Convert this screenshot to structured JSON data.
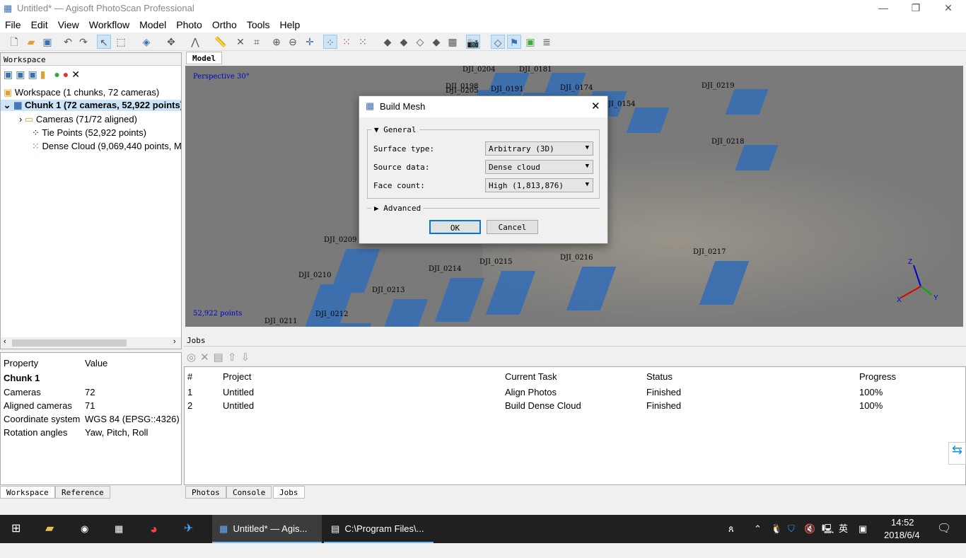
{
  "window": {
    "title": "Untitled* — Agisoft PhotoScan Professional"
  },
  "menu": [
    "File",
    "Edit",
    "View",
    "Workflow",
    "Model",
    "Photo",
    "Ortho",
    "Tools",
    "Help"
  ],
  "workspace": {
    "title": "Workspace",
    "root": "Workspace (1 chunks, 72 cameras)",
    "chunk": "Chunk 1 (72 cameras, 52,922 points)",
    "cameras": "Cameras (71/72 aligned)",
    "tie_points": "Tie Points (52,922 points)",
    "dense_cloud": "Dense Cloud (9,069,440 points, M"
  },
  "properties": {
    "header": [
      "Property",
      "Value"
    ],
    "group": "Chunk 1",
    "rows": [
      [
        "Cameras",
        "72"
      ],
      [
        "Aligned cameras",
        "71"
      ],
      [
        "Coordinate system",
        "WGS 84 (EPSG::4326)"
      ],
      [
        "Rotation angles",
        "Yaw, Pitch, Roll"
      ]
    ]
  },
  "left_tabs": [
    "Workspace",
    "Reference"
  ],
  "model": {
    "tab": "Model",
    "projection": "Perspective 30°",
    "points": "52,922 points",
    "cameras": [
      "DJI_0204",
      "DJI_0181",
      "DJI_0198",
      "DJI_0205",
      "DJI_0191",
      "DJI_0174",
      "DJI_0154",
      "DJI_0219",
      "DJI_0218",
      "DJI_0209",
      "DJI_0210",
      "DJI_0214",
      "DJI_0215",
      "DJI_0216",
      "DJI_0217",
      "DJI_0213",
      "DJI_0212",
      "DJI_0211"
    ],
    "axes": [
      "Z",
      "X",
      "Y"
    ]
  },
  "dialog": {
    "title": "Build Mesh",
    "general": "General",
    "advanced": "Advanced",
    "fields": [
      {
        "label": "Surface type:",
        "value": "Arbitrary (3D)"
      },
      {
        "label": "Source data:",
        "value": "Dense cloud"
      },
      {
        "label": "Face count:",
        "value": "High (1,813,876)"
      }
    ],
    "ok": "OK",
    "cancel": "Cancel"
  },
  "jobs": {
    "title": "Jobs",
    "columns": [
      "#",
      "Project",
      "Current Task",
      "Status",
      "Progress"
    ],
    "rows": [
      [
        "1",
        "Untitled",
        "Align Photos",
        "Finished",
        "100%"
      ],
      [
        "2",
        "Untitled",
        "Build Dense Cloud",
        "Finished",
        "100%"
      ]
    ]
  },
  "bottom_tabs": [
    "Photos",
    "Console",
    "Jobs"
  ],
  "taskbar": {
    "apps": [
      "Untitled* — Agis...",
      "C:\\Program Files\\..."
    ],
    "ime": "英",
    "time": "14:52",
    "date": "2018/6/4"
  }
}
